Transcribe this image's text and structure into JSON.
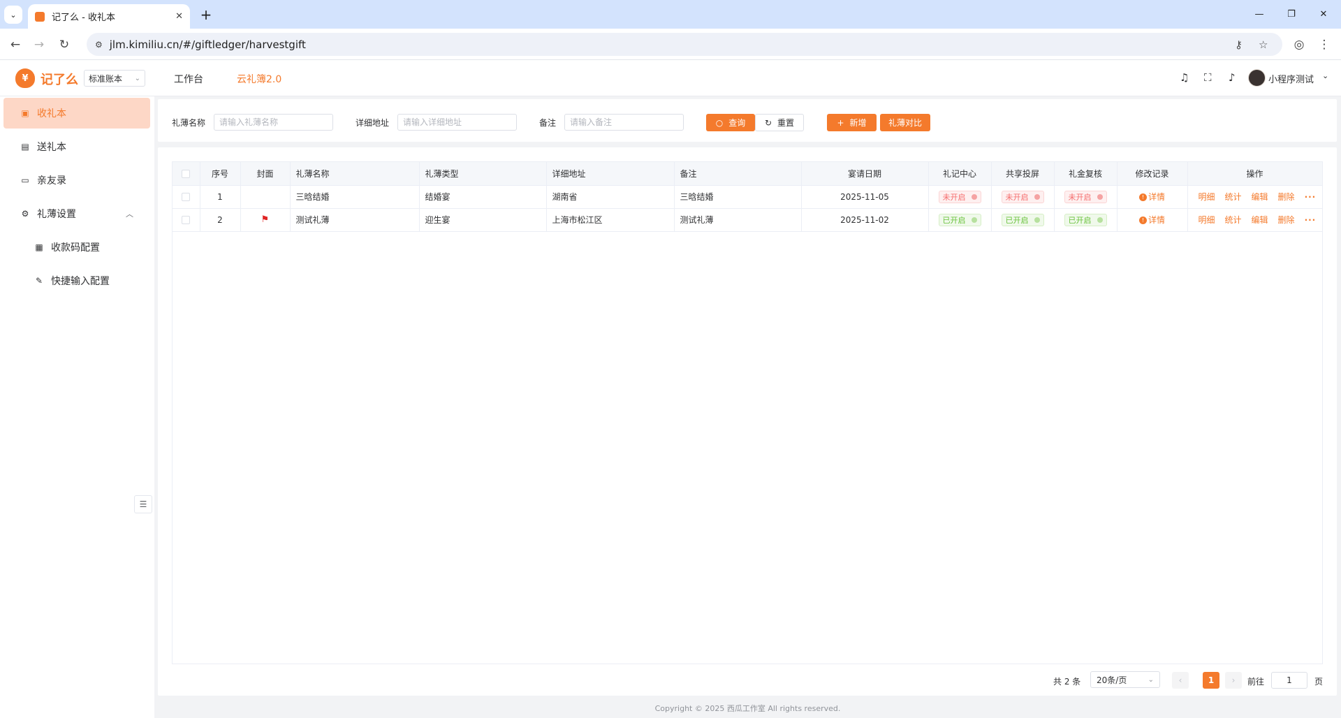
{
  "browser": {
    "tab_title": "记了么 - 收礼本",
    "url": "jlm.kimiliu.cn/#/giftledger/harvestgift"
  },
  "header": {
    "logo_text": "记了么",
    "logo_glyph": "¥",
    "ledger_select": "标准账本",
    "nav_workbench": "工作台",
    "nav_cloud": "云礼簿2.0",
    "username": "小程序测试"
  },
  "sidebar": {
    "items": [
      {
        "label": "收礼本",
        "icon": "ledger-icon"
      },
      {
        "label": "送礼本",
        "icon": "gift-icon"
      },
      {
        "label": "亲友录",
        "icon": "folder-icon"
      },
      {
        "label": "礼薄设置",
        "icon": "gear-icon"
      },
      {
        "label": "收款码配置",
        "icon": "qrcode-icon"
      },
      {
        "label": "快捷输入配置",
        "icon": "edit-icon"
      }
    ]
  },
  "search": {
    "name_label": "礼薄名称",
    "name_placeholder": "请输入礼薄名称",
    "address_label": "详细地址",
    "address_placeholder": "请输入详细地址",
    "remark_label": "备注",
    "remark_placeholder": "请输入备注",
    "query_label": "查询",
    "reset_label": "重置",
    "add_label": "新增",
    "compare_label": "礼薄对比"
  },
  "table": {
    "columns": [
      "序号",
      "封面",
      "礼薄名称",
      "礼薄类型",
      "详细地址",
      "备注",
      "宴请日期",
      "礼记中心",
      "共享投屏",
      "礼金复核",
      "修改记录",
      "操作"
    ],
    "rows": [
      {
        "index": "1",
        "has_cover": false,
        "name": "三晗结婚",
        "type": "结婚宴",
        "address": "湖南省",
        "remark": "三晗结婚",
        "date": "2025-11-05",
        "center": "未开启",
        "share": "未开启",
        "review": "未开启",
        "record": "详情",
        "status": "off"
      },
      {
        "index": "2",
        "has_cover": true,
        "name": "测试礼薄",
        "type": "迎生宴",
        "address": "上海市松江区",
        "remark": "测试礼薄",
        "date": "2025-11-02",
        "center": "已开启",
        "share": "已开启",
        "review": "已开启",
        "record": "详情",
        "status": "on"
      }
    ],
    "ops": [
      "明细",
      "统计",
      "编辑",
      "删除"
    ]
  },
  "pagination": {
    "total": "共 2 条",
    "page_size": "20条/页",
    "current_page": "1",
    "goto_label": "前往",
    "goto_value": "1",
    "page_suffix": "页"
  },
  "footer": "Copyright © 2025 西瓜工作室 All rights reserved.",
  "colors": {
    "brand": "#f47a2c",
    "on": "#67c23a",
    "off": "#f56c6c"
  }
}
